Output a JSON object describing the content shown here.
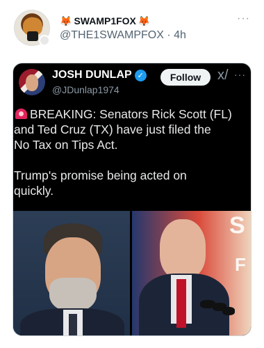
{
  "outer_post": {
    "display_name": "SWAMP1FOX",
    "fox_emoji": "🦊",
    "handle": "@THE1SWAMPFOX",
    "separator": "·",
    "time": "4h",
    "more": "···"
  },
  "quoted_post": {
    "display_name": "JOSH DUNLAP",
    "verified_mark": "✓",
    "handle": "@JDunlap1974",
    "follow_label": "Follow",
    "grok_icon": "x/",
    "more": "···",
    "text_line_1": "BREAKING: Senators Rick Scott (FL)",
    "text_line_2": "and Ted Cruz (TX) have just filed the",
    "text_line_3": "No Tax on Tips Act.",
    "text_line_4": "Trump's promise being acted on",
    "text_line_5": "quickly.",
    "bg_letter_s": "S",
    "bg_letter_f": "F"
  },
  "icons": {
    "siren": "siren-icon",
    "verified": "verified-badge-icon",
    "grok": "grok-icon"
  },
  "colors": {
    "card_bg": "#000000",
    "verified_blue": "#1d9bf0",
    "handle_gray": "#536471",
    "siren_red": "#e0245e"
  }
}
